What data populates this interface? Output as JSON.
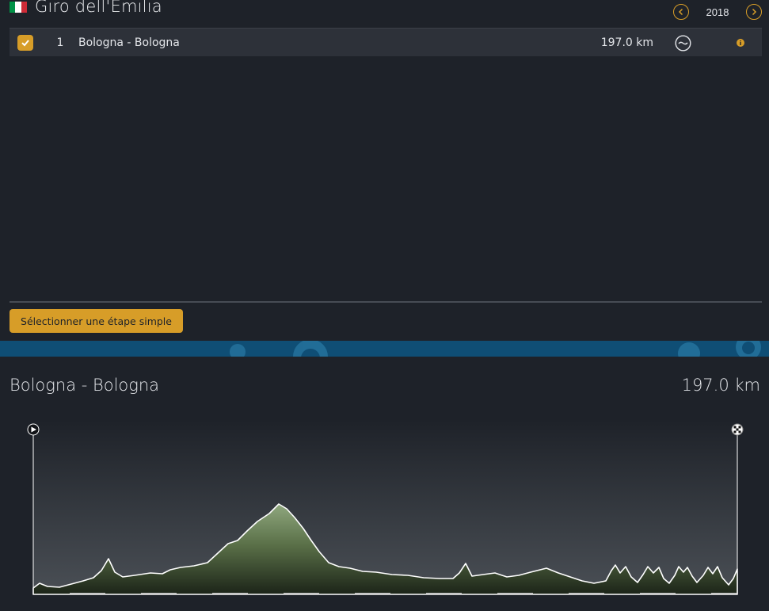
{
  "race": {
    "title": "Giro dell'Emilia",
    "flag_colors": [
      "#009246",
      "#ffffff",
      "#ce2b37"
    ]
  },
  "year_nav": {
    "year": "2018",
    "prev_icon": "chevron-left-icon",
    "next_icon": "chevron-right-icon"
  },
  "stages": [
    {
      "checked": true,
      "number": "1",
      "name": "Bologna - Bologna",
      "distance": "197.0 km",
      "terrain_icon": "wave-terrain-icon",
      "info_icon": "info-icon"
    }
  ],
  "select_button": "Sélectionner une étape simple",
  "profile": {
    "title": "Bologna - Bologna",
    "distance": "197.0 km",
    "start_icon": "play-icon",
    "finish_icon": "checkered-flag-icon"
  },
  "colors": {
    "accent": "#d79d28",
    "background": "#1e2229",
    "row_background": "#2d3139",
    "banner": "#0f4e75"
  }
}
